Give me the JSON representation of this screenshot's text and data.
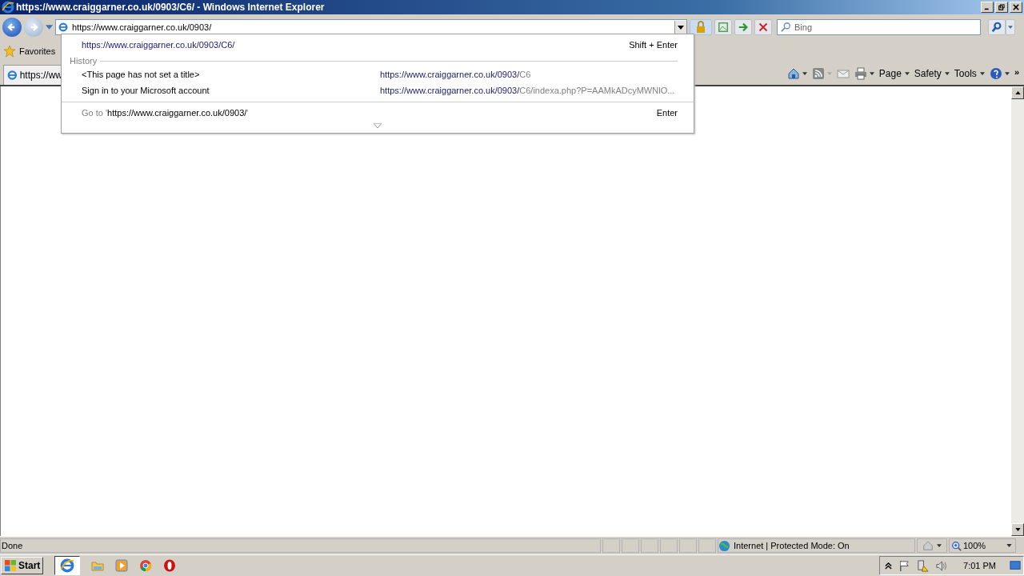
{
  "window": {
    "title": "https://www.craiggarner.co.uk/0903/C6/ - Windows Internet Explorer"
  },
  "address_bar": {
    "value": "https://www.craiggarner.co.uk/0903/"
  },
  "search": {
    "placeholder": "Bing"
  },
  "favorites": {
    "label": "Favorites"
  },
  "tab": {
    "title": "https://ww"
  },
  "command_bar": {
    "items": [
      {
        "label": "Page"
      },
      {
        "label": "Safety"
      },
      {
        "label": "Tools"
      }
    ],
    "overflow": "»"
  },
  "dropdown": {
    "suggestion": {
      "url": "https://www.craiggarner.co.uk/0903/C6/",
      "shortcut": "Shift + Enter"
    },
    "history_label": "History",
    "history": [
      {
        "title": "<This page has not set a title>",
        "url_match": "https://www.craiggarner.co.uk/0903/",
        "url_rest": "C6"
      },
      {
        "title": "Sign in to your Microsoft account",
        "url_match": "https://www.craiggarner.co.uk/0903/",
        "url_rest": "C6/indexa.php?P=AAMkADcyMWNlO..."
      }
    ],
    "go_to": {
      "prefix": "Go to '",
      "url": "https://www.craiggarner.co.uk/0903/",
      "suffix": "'",
      "shortcut": "Enter"
    }
  },
  "status_bar": {
    "text": "Done",
    "zone": "Internet | Protected Mode: On",
    "zoom": "100%"
  },
  "taskbar": {
    "start": "Start",
    "clock": "7:01 PM"
  }
}
